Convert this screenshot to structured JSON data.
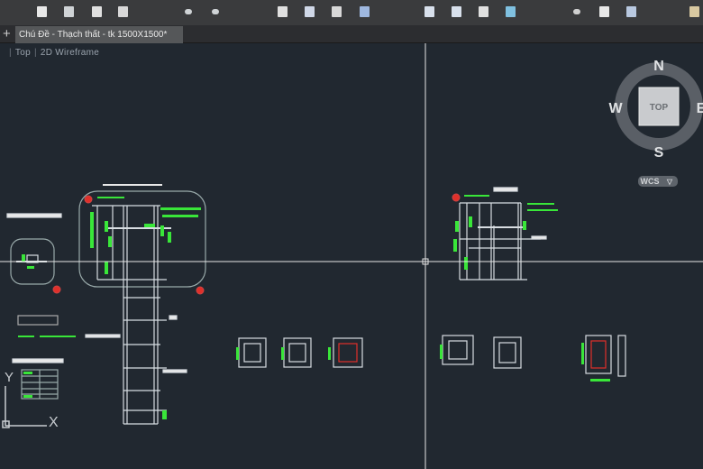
{
  "toolbar": {
    "icons": [
      "new-icon",
      "open-icon",
      "save-icon",
      "save-as-icon",
      "undo-icon",
      "redo-icon",
      "plot-icon",
      "plot-preview-icon",
      "publish-icon",
      "sheet-set-icon",
      "import-icon",
      "export-icon",
      "layout-icon",
      "web-icon",
      "zoom-icon",
      "pan-icon",
      "orbit-icon",
      "properties-icon"
    ]
  },
  "tabs": {
    "new_tab_label": "+",
    "active": "Chú Đề - Thạch thất - tk 1500X1500*"
  },
  "viewport": {
    "view": "Top",
    "visual_style": "2D Wireframe"
  },
  "viewcube": {
    "north": "N",
    "south": "S",
    "east": "E",
    "west": "W",
    "face": "TOP",
    "ucs": "WCS",
    "ucs_arrow": "▽"
  },
  "ucs_icon": {
    "x_label": "X",
    "y_label": "Y"
  },
  "colors": {
    "canvas": "#212830",
    "geometry": "#d8dde2",
    "annotation": "#39e639",
    "marker": "#e0302a"
  }
}
